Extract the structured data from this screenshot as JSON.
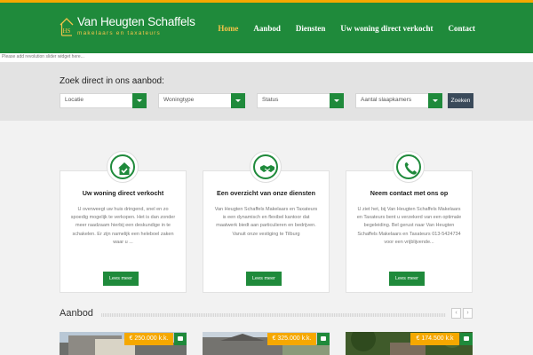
{
  "header": {
    "logo_mark": "HS",
    "logo_name": "Van Heugten Schaffels",
    "logo_sub": "makelaars en taxateurs",
    "nav": [
      {
        "label": "Home",
        "active": true
      },
      {
        "label": "Aanbod",
        "active": false
      },
      {
        "label": "Diensten",
        "active": false
      },
      {
        "label": "Uw woning direct verkocht",
        "active": false
      },
      {
        "label": "Contact",
        "active": false
      }
    ]
  },
  "slider_notice": "Please add revolution slider widget here...",
  "search": {
    "title": "Zoek direct in ons aanbod:",
    "selects": [
      "Locatie",
      "Woningtype",
      "Status",
      "Aantal slaapkamers"
    ],
    "button": "Zoeken"
  },
  "cards": [
    {
      "icon": "house-check-icon",
      "title": "Uw woning direct verkocht",
      "text": "U overweegt uw huis dringend, snel en zo spoedig mogelijk te verkopen. Het is dan zonder meer raadzaam hierbij een deskundige in te schakelen. Er zijn namelijk een heleboel zaken waar u ...",
      "button": "Lees meer"
    },
    {
      "icon": "handshake-icon",
      "title": "Een overzicht van onze diensten",
      "text": "Van Heugten Schaffels Makelaars en Taxateurs is een dynamisch en flexibel kantoor dat maatwerk biedt aan particulieren en bedrijven. Vanuit onze vestiging te Tilburg",
      "button": "Lees meer"
    },
    {
      "icon": "phone-icon",
      "title": "Neem contact met ons op",
      "text": "U ziet het, bij Van Heugten Schaffels Makelaars en Taxateurs bent u verzekerd van een optimale begeleiding. Bel gerust naar Van Heugten Schaffels Makelaars en Taxateurs 013-5424734 voor een vrijblijvende...",
      "button": "Lees meer"
    }
  ],
  "aanbod": {
    "title": "Aanbod",
    "prev": "‹",
    "next": "›",
    "listings": [
      {
        "price": "€ 250.000 k.k."
      },
      {
        "price": "€ 325.000 k.k."
      },
      {
        "price": "€ 174.500 k.k"
      }
    ]
  },
  "colors": {
    "brand_green": "#1f8a3b",
    "accent_orange": "#f5a800",
    "nav_active": "#f5c34a"
  }
}
